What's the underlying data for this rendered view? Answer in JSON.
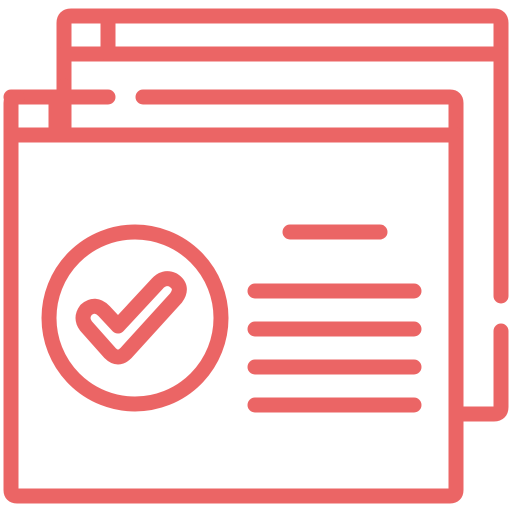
{
  "icon": {
    "name": "approved-web-page-icon",
    "accent_color": "#EB6565",
    "background_color": "#FFFFFF",
    "elements": [
      "back-browser-window-icon",
      "front-browser-window-icon",
      "check-circle-icon",
      "checkmark-icon",
      "content-lines-icon"
    ]
  }
}
